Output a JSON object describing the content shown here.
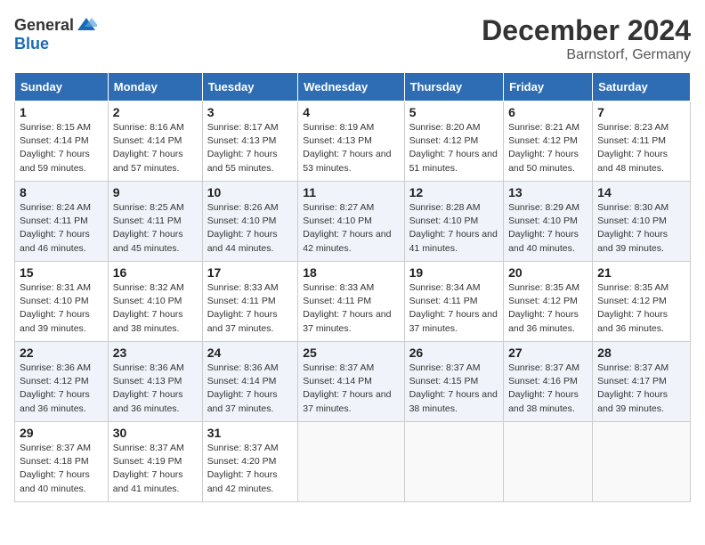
{
  "logo": {
    "general": "General",
    "blue": "Blue"
  },
  "header": {
    "month": "December 2024",
    "location": "Barnstorf, Germany"
  },
  "weekdays": [
    "Sunday",
    "Monday",
    "Tuesday",
    "Wednesday",
    "Thursday",
    "Friday",
    "Saturday"
  ],
  "weeks": [
    [
      {
        "day": "1",
        "sunrise": "8:15 AM",
        "sunset": "4:14 PM",
        "daylight": "7 hours and 59 minutes."
      },
      {
        "day": "2",
        "sunrise": "8:16 AM",
        "sunset": "4:14 PM",
        "daylight": "7 hours and 57 minutes."
      },
      {
        "day": "3",
        "sunrise": "8:17 AM",
        "sunset": "4:13 PM",
        "daylight": "7 hours and 55 minutes."
      },
      {
        "day": "4",
        "sunrise": "8:19 AM",
        "sunset": "4:13 PM",
        "daylight": "7 hours and 53 minutes."
      },
      {
        "day": "5",
        "sunrise": "8:20 AM",
        "sunset": "4:12 PM",
        "daylight": "7 hours and 51 minutes."
      },
      {
        "day": "6",
        "sunrise": "8:21 AM",
        "sunset": "4:12 PM",
        "daylight": "7 hours and 50 minutes."
      },
      {
        "day": "7",
        "sunrise": "8:23 AM",
        "sunset": "4:11 PM",
        "daylight": "7 hours and 48 minutes."
      }
    ],
    [
      {
        "day": "8",
        "sunrise": "8:24 AM",
        "sunset": "4:11 PM",
        "daylight": "7 hours and 46 minutes."
      },
      {
        "day": "9",
        "sunrise": "8:25 AM",
        "sunset": "4:11 PM",
        "daylight": "7 hours and 45 minutes."
      },
      {
        "day": "10",
        "sunrise": "8:26 AM",
        "sunset": "4:10 PM",
        "daylight": "7 hours and 44 minutes."
      },
      {
        "day": "11",
        "sunrise": "8:27 AM",
        "sunset": "4:10 PM",
        "daylight": "7 hours and 42 minutes."
      },
      {
        "day": "12",
        "sunrise": "8:28 AM",
        "sunset": "4:10 PM",
        "daylight": "7 hours and 41 minutes."
      },
      {
        "day": "13",
        "sunrise": "8:29 AM",
        "sunset": "4:10 PM",
        "daylight": "7 hours and 40 minutes."
      },
      {
        "day": "14",
        "sunrise": "8:30 AM",
        "sunset": "4:10 PM",
        "daylight": "7 hours and 39 minutes."
      }
    ],
    [
      {
        "day": "15",
        "sunrise": "8:31 AM",
        "sunset": "4:10 PM",
        "daylight": "7 hours and 39 minutes."
      },
      {
        "day": "16",
        "sunrise": "8:32 AM",
        "sunset": "4:10 PM",
        "daylight": "7 hours and 38 minutes."
      },
      {
        "day": "17",
        "sunrise": "8:33 AM",
        "sunset": "4:11 PM",
        "daylight": "7 hours and 37 minutes."
      },
      {
        "day": "18",
        "sunrise": "8:33 AM",
        "sunset": "4:11 PM",
        "daylight": "7 hours and 37 minutes."
      },
      {
        "day": "19",
        "sunrise": "8:34 AM",
        "sunset": "4:11 PM",
        "daylight": "7 hours and 37 minutes."
      },
      {
        "day": "20",
        "sunrise": "8:35 AM",
        "sunset": "4:12 PM",
        "daylight": "7 hours and 36 minutes."
      },
      {
        "day": "21",
        "sunrise": "8:35 AM",
        "sunset": "4:12 PM",
        "daylight": "7 hours and 36 minutes."
      }
    ],
    [
      {
        "day": "22",
        "sunrise": "8:36 AM",
        "sunset": "4:12 PM",
        "daylight": "7 hours and 36 minutes."
      },
      {
        "day": "23",
        "sunrise": "8:36 AM",
        "sunset": "4:13 PM",
        "daylight": "7 hours and 36 minutes."
      },
      {
        "day": "24",
        "sunrise": "8:36 AM",
        "sunset": "4:14 PM",
        "daylight": "7 hours and 37 minutes."
      },
      {
        "day": "25",
        "sunrise": "8:37 AM",
        "sunset": "4:14 PM",
        "daylight": "7 hours and 37 minutes."
      },
      {
        "day": "26",
        "sunrise": "8:37 AM",
        "sunset": "4:15 PM",
        "daylight": "7 hours and 38 minutes."
      },
      {
        "day": "27",
        "sunrise": "8:37 AM",
        "sunset": "4:16 PM",
        "daylight": "7 hours and 38 minutes."
      },
      {
        "day": "28",
        "sunrise": "8:37 AM",
        "sunset": "4:17 PM",
        "daylight": "7 hours and 39 minutes."
      }
    ],
    [
      {
        "day": "29",
        "sunrise": "8:37 AM",
        "sunset": "4:18 PM",
        "daylight": "7 hours and 40 minutes."
      },
      {
        "day": "30",
        "sunrise": "8:37 AM",
        "sunset": "4:19 PM",
        "daylight": "7 hours and 41 minutes."
      },
      {
        "day": "31",
        "sunrise": "8:37 AM",
        "sunset": "4:20 PM",
        "daylight": "7 hours and 42 minutes."
      },
      null,
      null,
      null,
      null
    ]
  ]
}
